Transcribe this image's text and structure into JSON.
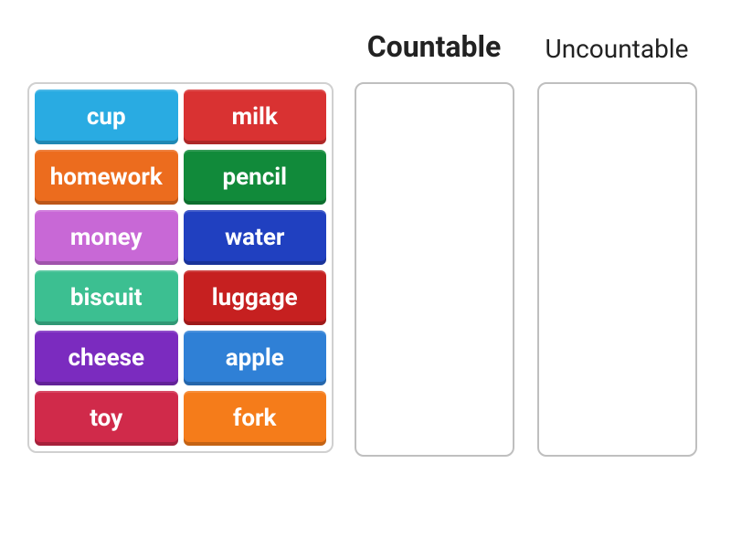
{
  "categories": [
    {
      "label": "Countable",
      "primary": true
    },
    {
      "label": "Uncountable",
      "primary": false
    }
  ],
  "tiles": [
    {
      "label": "cup",
      "color": "c-blue"
    },
    {
      "label": "milk",
      "color": "c-red"
    },
    {
      "label": "homework",
      "color": "c-orange"
    },
    {
      "label": "pencil",
      "color": "c-green"
    },
    {
      "label": "money",
      "color": "c-magenta"
    },
    {
      "label": "water",
      "color": "c-navy"
    },
    {
      "label": "biscuit",
      "color": "c-teal"
    },
    {
      "label": "luggage",
      "color": "c-crimson"
    },
    {
      "label": "cheese",
      "color": "c-purple"
    },
    {
      "label": "apple",
      "color": "c-blue2"
    },
    {
      "label": "toy",
      "color": "c-pink"
    },
    {
      "label": "fork",
      "color": "c-orange2"
    }
  ]
}
